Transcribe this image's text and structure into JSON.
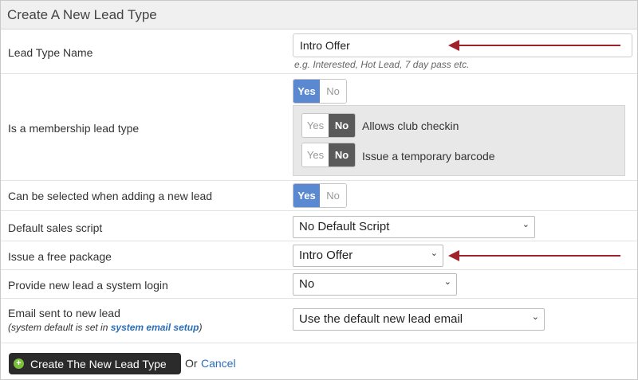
{
  "header": {
    "title": "Create A New Lead Type"
  },
  "lead_type_name": {
    "label": "Lead Type Name",
    "value": "Intro Offer",
    "hint": "e.g. Interested, Hot Lead, 7 day pass etc."
  },
  "membership": {
    "label": "Is a membership lead type",
    "yes": "Yes",
    "no": "No",
    "selected": "Yes",
    "club_checkin": {
      "yes": "Yes",
      "no": "No",
      "selected": "No",
      "label": "Allows club checkin"
    },
    "temp_barcode": {
      "yes": "Yes",
      "no": "No",
      "selected": "No",
      "label": "Issue a temporary barcode"
    }
  },
  "selectable_new_lead": {
    "label": "Can be selected when adding a new lead",
    "yes": "Yes",
    "no": "No",
    "selected": "Yes"
  },
  "sales_script": {
    "label": "Default sales script",
    "value": "No Default Script"
  },
  "free_package": {
    "label": "Issue a free package",
    "value": "Intro Offer"
  },
  "system_login": {
    "label": "Provide new lead a system login",
    "value": "No"
  },
  "email": {
    "label": "Email sent to new lead",
    "sublabel_prefix": "(system default is set in ",
    "sublabel_link": "system email setup",
    "sublabel_suffix": ")",
    "value": "Use the default new lead email"
  },
  "actions": {
    "create_label": "Create The New Lead Type",
    "or": "Or",
    "cancel_label": "Cancel"
  },
  "colors": {
    "toggle_on": "#5b89d1",
    "toggle_dark": "#5a5a5a",
    "arrow": "#a0222a",
    "link": "#2a6ebb",
    "add_icon": "#7bbf3a"
  },
  "icons": {
    "add": "plus-circle-icon",
    "dropdown": "chevron-down-icon",
    "annotation": "arrow-left-icon"
  }
}
